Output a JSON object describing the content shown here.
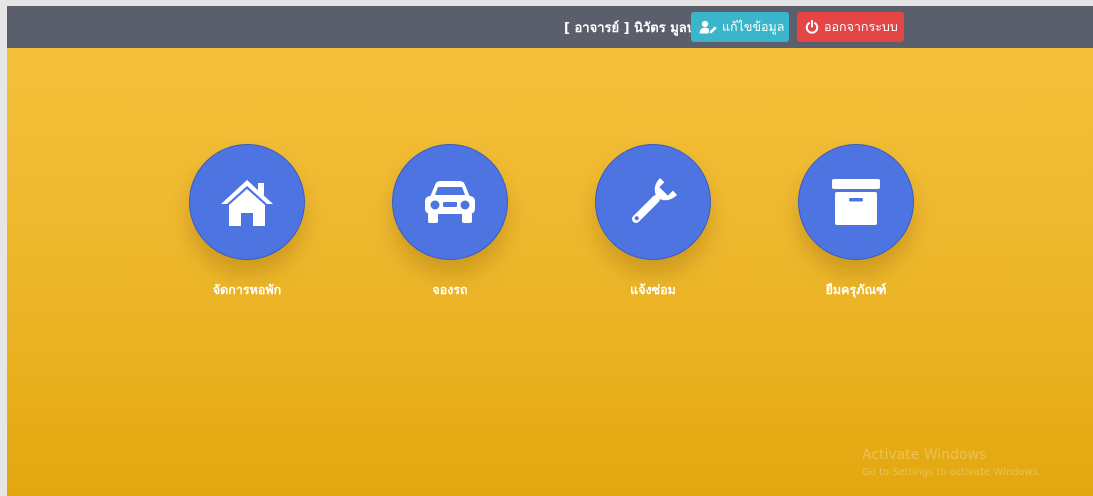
{
  "header": {
    "user_label": "[ อาจารย์ ] นิวัตร มูลปา",
    "edit_button": "แก้ไขข้อมูล",
    "logout_button": "ออกจากระบบ"
  },
  "menu": [
    {
      "label": "จัดการหอพัก",
      "icon": "home-icon"
    },
    {
      "label": "จองรถ",
      "icon": "car-icon"
    },
    {
      "label": "แจ้งซ่อม",
      "icon": "wrench-icon"
    },
    {
      "label": "ยืมครุภัณฑ์",
      "icon": "archive-box-icon"
    }
  ],
  "colors": {
    "topbar": "#5b5e6b",
    "edit_button": "#3bb5c9",
    "logout_button": "#e64545",
    "circle": "#4d74e0",
    "background_top": "#f5c23c",
    "background_bottom": "#e3a80f"
  },
  "watermark": {
    "title": "Activate Windows",
    "subtitle": "Go to Settings to activate Windows."
  }
}
